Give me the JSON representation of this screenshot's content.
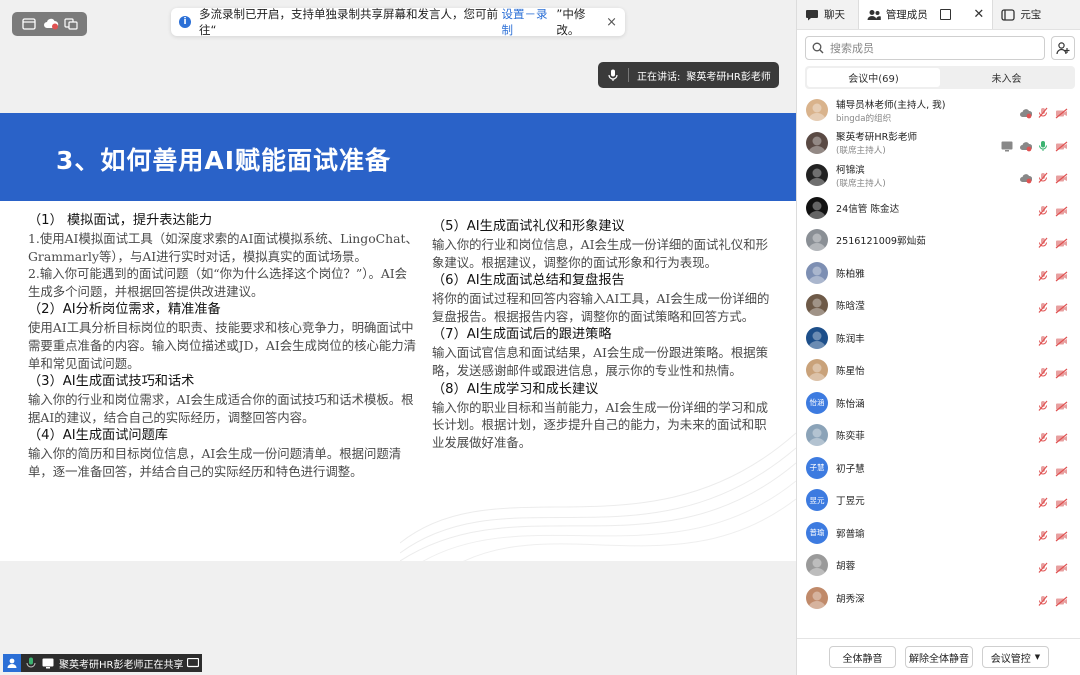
{
  "notice": {
    "text_before": "多流录制已开启，支持单独录制共享屏幕和发言人，您可前往“",
    "link": "设置－录制",
    "text_after": "”中修改。",
    "close": "×"
  },
  "speaker": {
    "label": "正在讲话:",
    "name": "聚英考研HR彭老师"
  },
  "slide": {
    "title": "3、如何善用AI赋能面试准备",
    "left_column": [
      {
        "heading": "（1） 模拟面试，提升表达能力",
        "paras": [
          "1.使用AI模拟面试工具（如深度求索的AI面试模拟系统、LingoChat、Grammarly等），与AI进行实时对话，模拟真实的面试场景。",
          "2.输入你可能遇到的面试问题（如“你为什么选择这个岗位？”）。AI会生成多个问题，并根据回答提供改进建议。"
        ]
      },
      {
        "heading": "（2）AI分析岗位需求，精准准备",
        "paras": [
          "使用AI工具分析目标岗位的职责、技能要求和核心竞争力，明确面试中需要重点准备的内容。输入岗位描述或JD，AI会生成岗位的核心能力清单和常见面试问题。"
        ]
      },
      {
        "heading": "（3）AI生成面试技巧和话术",
        "paras": [
          "输入你的行业和岗位需求，AI会生成适合你的面试技巧和话术模板。根据AI的建议，结合自己的实际经历，调整回答内容。"
        ]
      },
      {
        "heading": "（4）AI生成面试问题库",
        "paras": [
          "输入你的简历和目标岗位信息，AI会生成一份问题清单。根据问题清单，逐一准备回答，并结合自己的实际经历和特色进行调整。"
        ]
      }
    ],
    "right_column": [
      {
        "heading": "（5）AI生成面试礼仪和形象建议",
        "paras": [
          "输入你的行业和岗位信息，AI会生成一份详细的面试礼仪和形象建议。根据建议，调整你的面试形象和行为表现。"
        ]
      },
      {
        "heading": "（6）AI生成面试总结和复盘报告",
        "paras": [
          "将你的面试过程和回答内容输入AI工具，AI会生成一份详细的复盘报告。根据报告内容，调整你的面试策略和回答方式。"
        ]
      },
      {
        "heading": "（7）AI生成面试后的跟进策略",
        "paras": [
          "输入面试官信息和面试结果，AI会生成一份跟进策略。根据策略，发送感谢邮件或跟进信息，展示你的专业性和热情。"
        ]
      },
      {
        "heading": "（8）AI生成学习和成长建议",
        "paras": [
          "输入你的职业目标和当前能力，AI会生成一份详细的学习和成长计划。根据计划，逐步提升自己的能力，为未来的面试和职业发展做好准备。"
        ]
      }
    ]
  },
  "share_status": {
    "text": "聚英考研HR彭老师正在共享"
  },
  "panel": {
    "tabs": {
      "chat": "聊天",
      "members": "管理成员",
      "yuanbao": "元宝"
    },
    "search_placeholder": "搜索成员",
    "segments": {
      "in_meeting": "会议中(69)",
      "not_joined": "未入会"
    },
    "members": [
      {
        "name": "辅导员林老师(主持人, 我)",
        "role": "bingda的组织",
        "avatar_text": "",
        "avatar_color": "#d9b38c",
        "icons": [
          "cloud",
          "mic-off",
          "cam-off"
        ]
      },
      {
        "name": "聚英考研HR彭老师",
        "role": "(联席主持人)",
        "avatar_text": "",
        "avatar_color": "#5a4a44",
        "icons": [
          "share",
          "cloud",
          "mic-on",
          "cam-off"
        ]
      },
      {
        "name": "柯锦滨",
        "role": "(联席主持人)",
        "avatar_text": "",
        "avatar_color": "#222222",
        "icons": [
          "cloud",
          "mic-off",
          "cam-off"
        ]
      },
      {
        "name": "24信管 陈金达",
        "role": "",
        "avatar_text": "",
        "avatar_color": "#111111",
        "icons": [
          "mic-off",
          "cam-off"
        ]
      },
      {
        "name": "2516121009郭灿茹",
        "role": "",
        "avatar_text": "",
        "avatar_color": "#8a8f95",
        "icons": [
          "mic-off",
          "cam-off"
        ]
      },
      {
        "name": "陈柏雅",
        "role": "",
        "avatar_text": "",
        "avatar_color": "#7d8fb3",
        "icons": [
          "mic-off",
          "cam-off"
        ]
      },
      {
        "name": "陈晗滢",
        "role": "",
        "avatar_text": "",
        "avatar_color": "#6e5a48",
        "icons": [
          "mic-off",
          "cam-off"
        ]
      },
      {
        "name": "陈润丰",
        "role": "",
        "avatar_text": "",
        "avatar_color": "#1d4f8a",
        "icons": [
          "mic-off",
          "cam-off"
        ]
      },
      {
        "name": "陈星怡",
        "role": "",
        "avatar_text": "",
        "avatar_color": "#c9a27a",
        "icons": [
          "mic-off",
          "cam-off"
        ]
      },
      {
        "name": "陈怡涵",
        "role": "",
        "avatar_text": "怡涵",
        "avatar_color": "#3d7be0",
        "icons": [
          "mic-off",
          "cam-off"
        ]
      },
      {
        "name": "陈奕菲",
        "role": "",
        "avatar_text": "",
        "avatar_color": "#8ba3b8",
        "icons": [
          "mic-off",
          "cam-off"
        ]
      },
      {
        "name": "初子慧",
        "role": "",
        "avatar_text": "子慧",
        "avatar_color": "#3d7be0",
        "icons": [
          "mic-off",
          "cam-off"
        ]
      },
      {
        "name": "丁昱元",
        "role": "",
        "avatar_text": "昱元",
        "avatar_color": "#3d7be0",
        "icons": [
          "mic-off",
          "cam-off"
        ]
      },
      {
        "name": "郭普瑜",
        "role": "",
        "avatar_text": "普瑜",
        "avatar_color": "#3d7be0",
        "icons": [
          "mic-off",
          "cam-off"
        ]
      },
      {
        "name": "胡蓉",
        "role": "",
        "avatar_text": "",
        "avatar_color": "#9a9a9a",
        "icons": [
          "mic-off",
          "cam-off"
        ]
      },
      {
        "name": "胡秀深",
        "role": "",
        "avatar_text": "",
        "avatar_color": "#c08a6a",
        "icons": [
          "mic-off",
          "cam-off"
        ]
      }
    ],
    "footer": {
      "mute_all": "全体静音",
      "unmute_all": "解除全体静音",
      "control": "会议管控"
    }
  },
  "colors": {
    "accent": "#2b6fd6",
    "slide_band": "#2a62c8",
    "muted_red": "#e05252",
    "mic_green": "#3cb371"
  }
}
